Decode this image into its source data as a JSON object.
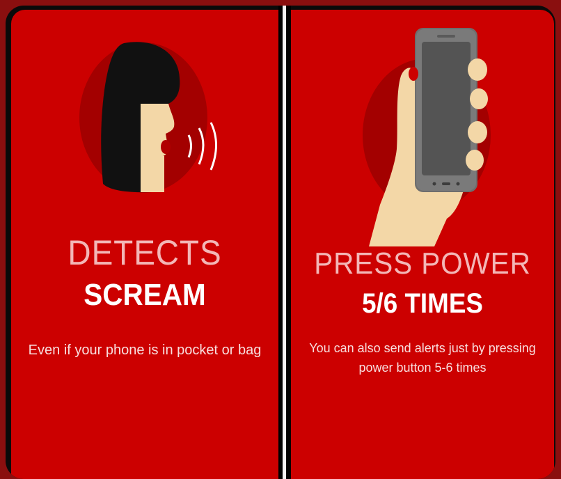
{
  "panels": [
    {
      "title_line1": "DETECTS",
      "title_line2": "SCREAM",
      "description": "Even if your phone is in pocket or bag",
      "icon": "screaming-woman-icon"
    },
    {
      "title_line1": "PRESS POWER",
      "title_line2": "5/6 TIMES",
      "description_line1": "You can also send alerts just by pressing",
      "description_line2": "power button 5-6 times",
      "icon": "hand-holding-phone-icon"
    }
  ],
  "colors": {
    "panel_background": "#cc0000",
    "circle": "#a30000",
    "hair": "#111111",
    "skin": "#f3d7a7",
    "phone": "#6e6e6e",
    "screen": "#545454"
  }
}
